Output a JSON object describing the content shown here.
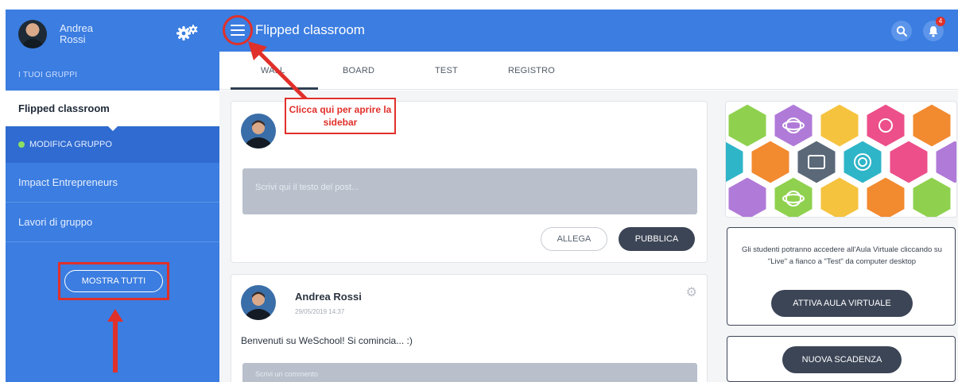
{
  "user": {
    "first_name": "Andrea",
    "last_name": "Rossi"
  },
  "sidebar": {
    "section_label": "I TUOI GRUPPI",
    "active_group": "Flipped classroom",
    "modify_label": "MODIFICA GRUPPO",
    "groups": [
      "Impact Entrepreneurs",
      "Lavori di gruppo"
    ],
    "show_all_label": "MOSTRA TUTTI"
  },
  "topbar": {
    "title": "Flipped classroom",
    "notification_count": "4"
  },
  "tabs": [
    {
      "label": "WALL",
      "active": true
    },
    {
      "label": "BOARD"
    },
    {
      "label": "TEST"
    },
    {
      "label": "REGISTRO"
    }
  ],
  "composer": {
    "placeholder": "Scrivi qui il testo del post...",
    "attach_label": "ALLEGA",
    "publish_label": "PUBBLICA"
  },
  "post": {
    "author": "Andrea Rossi",
    "date": "29/05/2019 14:37",
    "text": "Benvenuti su WeSchool! Si comincia... :)",
    "comment_placeholder": "Scrivi un commento"
  },
  "virtual_class": {
    "info": "Gli studenti potranno accedere all'Aula Virtuale cliccando su \"Live\" a fianco a \"Test\" da computer desktop",
    "button_label": "ATTIVA AULA VIRTUALE"
  },
  "deadline": {
    "button_label": "NUOVA SCADENZA"
  },
  "annotation": {
    "callout_text": "Clicca qui per aprire la sidebar"
  },
  "colors": {
    "primary": "#3b7de0",
    "dark_button": "#3c4556",
    "highlight": "#e0302a"
  }
}
